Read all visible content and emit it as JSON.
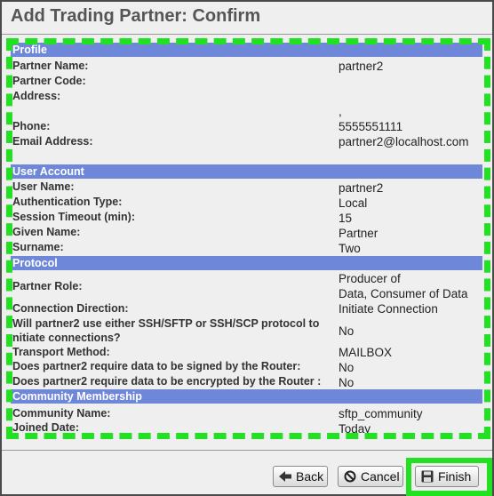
{
  "title": "Add Trading Partner: Confirm",
  "sections": {
    "profile": "Profile",
    "user_account": "User Account",
    "protocol": "Protocol",
    "community": "Community Membership"
  },
  "profile": {
    "partner_name_label": "Partner Name:",
    "partner_name_value": "partner2",
    "partner_code_label": "Partner Code:",
    "address_label": "Address:",
    "address_value": ",",
    "phone_label": "Phone:",
    "phone_value": "5555551111",
    "email_label": "Email Address:",
    "email_value": "partner2@localhost.com"
  },
  "user_account": {
    "user_name_label": "User Name:",
    "user_name_value": "partner2",
    "auth_type_label": "Authentication Type:",
    "auth_type_value": "Local",
    "session_timeout_label": "Session Timeout (min):",
    "session_timeout_value": "15",
    "given_name_label": "Given Name:",
    "given_name_value": "Partner",
    "surname_label": "Surname:",
    "surname_value": "Two"
  },
  "protocol": {
    "partner_role_label": "Partner Role:",
    "partner_role_value_line1": "Producer of",
    "partner_role_value_line2": "Data, Consumer of Data",
    "connection_direction_label": "Connection Direction:",
    "connection_direction_value": "Initiate Connection",
    "ssh_question_line1": "Will partner2 use either SSH/SFTP or SSH/SCP protocol to",
    "ssh_question_line2": "nitiate connections?",
    "ssh_value": "No",
    "transport_method_label": "Transport Method:",
    "transport_method_value": "MAILBOX",
    "signed_label": "Does partner2 require data to be signed by the Router:",
    "signed_value": "No",
    "encrypted_label": "Does partner2 require data to be encrypted by the Router :",
    "encrypted_value": "No"
  },
  "community": {
    "community_name_label": "Community Name:",
    "community_name_value": "sftp_community",
    "joined_date_label": "Joined Date:",
    "joined_date_value": "Today"
  },
  "buttons": {
    "back": "Back",
    "cancel": "Cancel",
    "finish": "Finish"
  },
  "icons": {
    "back": "arrow-left-icon",
    "cancel": "cancel-icon",
    "finish": "save-disk-icon"
  },
  "colors": {
    "section_header": "#6f87d9",
    "highlight": "#22e022",
    "background": "#efefef"
  }
}
